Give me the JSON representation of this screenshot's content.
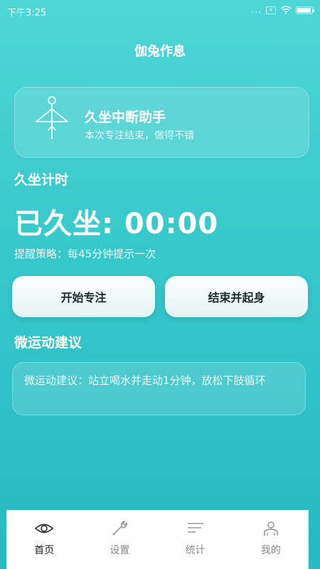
{
  "status": {
    "time": "下午3:25",
    "signal_dots": "...",
    "sim_label": "x",
    "battery_level": 0.95
  },
  "app": {
    "title": "伽兔作息"
  },
  "assistant": {
    "icon": "meditation-figure-icon",
    "title": "久坐中断助手",
    "subtitle": "本次专注结束，做得不错"
  },
  "timer": {
    "section_title": "久坐计时",
    "counter": "已久坐: 00:00",
    "strategy": "提醒策略：每45分钟提示一次"
  },
  "buttons": {
    "start": "开始专注",
    "end": "结束并起身"
  },
  "exercise": {
    "section_title": "微运动建议",
    "text": "微运动建议：站立喝水并走动1分钟，放松下肢循环"
  },
  "tabs": [
    {
      "label": "首页",
      "icon": "eye-icon",
      "active": true
    },
    {
      "label": "设置",
      "icon": "wrench-icon",
      "active": false
    },
    {
      "label": "统计",
      "icon": "list-lines-icon",
      "active": false
    },
    {
      "label": "我的",
      "icon": "person-icon",
      "active": false
    }
  ],
  "colors": {
    "bg_top": "#4fd6d6",
    "bg_bottom": "#27b9c0",
    "button_text": "#1c2a2c"
  }
}
